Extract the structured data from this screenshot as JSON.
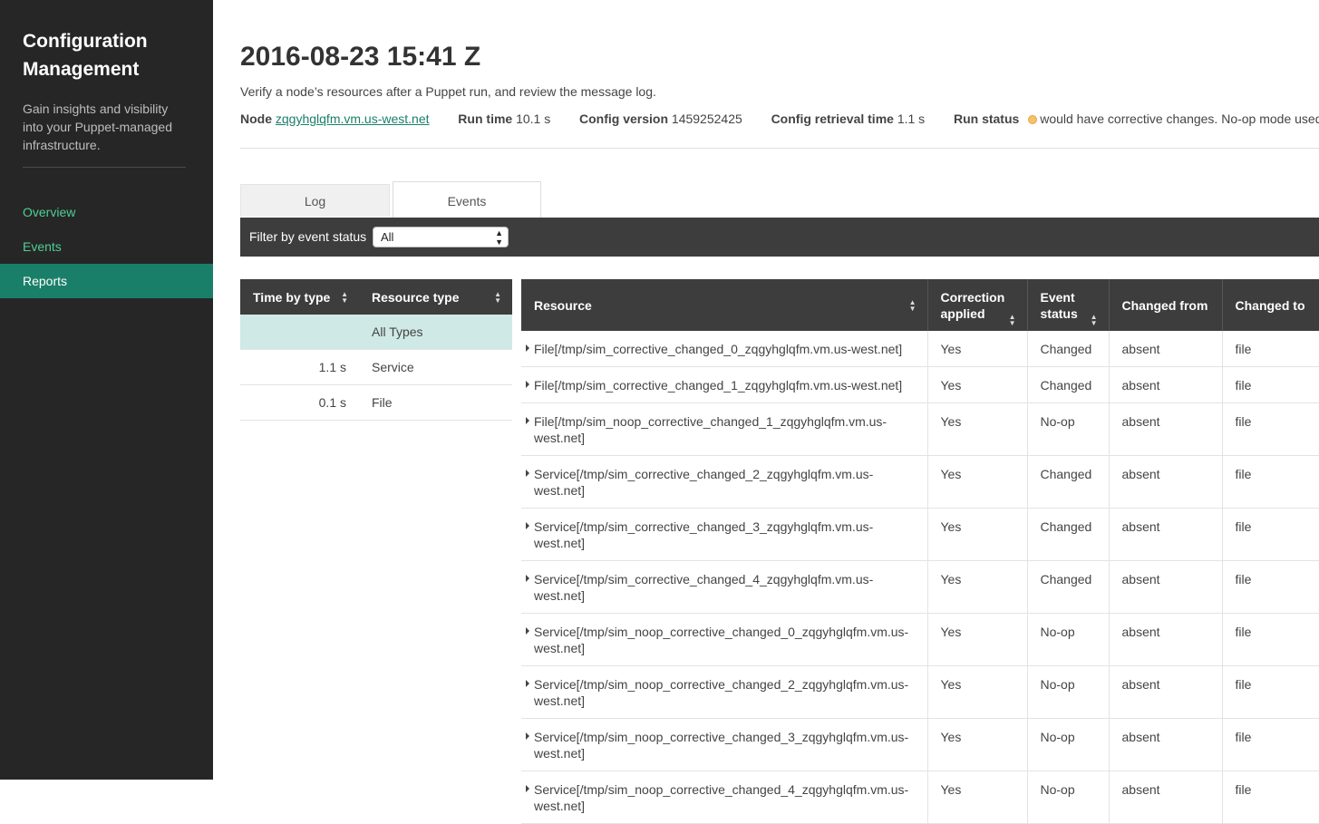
{
  "sidebar": {
    "title": "Configuration Management",
    "tagline": "Gain insights and visibility into your Puppet-managed infrastructure.",
    "nav": [
      {
        "label": "Overview"
      },
      {
        "label": "Events"
      },
      {
        "label": "Reports"
      }
    ]
  },
  "header": {
    "title": "2016-08-23 15:41 Z",
    "subtitle": "Verify a node’s resources after a Puppet run, and review the message log."
  },
  "meta": {
    "node_label": "Node",
    "node_value": "zqgyhglqfm.vm.us-west.net",
    "run_time_label": "Run time",
    "run_time_value": "10.1 s",
    "config_version_label": "Config version",
    "config_version_value": "1459252425",
    "config_retrieval_label": "Config retrieval time",
    "config_retrieval_value": "1.1 s",
    "run_status_label": "Run status",
    "run_status_value": "would have corrective changes. No-op mode used."
  },
  "tabs": [
    {
      "label": "Log"
    },
    {
      "label": "Events"
    }
  ],
  "filter": {
    "label": "Filter by event status",
    "selected": "All"
  },
  "types_table": {
    "headers": {
      "time": "Time by type",
      "type": "Resource type"
    },
    "rows": [
      {
        "time": "",
        "type": "All Types"
      },
      {
        "time": "1.1 s",
        "type": "Service"
      },
      {
        "time": "0.1 s",
        "type": "File"
      }
    ]
  },
  "events_table": {
    "headers": {
      "resource": "Resource",
      "correction": "Correction applied",
      "status": "Event status",
      "from": "Changed from",
      "to": "Changed to"
    },
    "rows": [
      {
        "resource": "File[/tmp/sim_corrective_changed_0_zqgyhglqfm.vm.us-west.net]",
        "correction": "Yes",
        "status": "Changed",
        "from": "absent",
        "to": "file"
      },
      {
        "resource": "File[/tmp/sim_corrective_changed_1_zqgyhglqfm.vm.us-west.net]",
        "correction": "Yes",
        "status": "Changed",
        "from": "absent",
        "to": "file"
      },
      {
        "resource": "File[/tmp/sim_noop_corrective_changed_1_zqgyhglqfm.vm.us-west.net]",
        "correction": "Yes",
        "status": "No-op",
        "from": "absent",
        "to": "file"
      },
      {
        "resource": "Service[/tmp/sim_corrective_changed_2_zqgyhglqfm.vm.us-west.net]",
        "correction": "Yes",
        "status": "Changed",
        "from": "absent",
        "to": "file"
      },
      {
        "resource": "Service[/tmp/sim_corrective_changed_3_zqgyhglqfm.vm.us-west.net]",
        "correction": "Yes",
        "status": "Changed",
        "from": "absent",
        "to": "file"
      },
      {
        "resource": "Service[/tmp/sim_corrective_changed_4_zqgyhglqfm.vm.us-west.net]",
        "correction": "Yes",
        "status": "Changed",
        "from": "absent",
        "to": "file"
      },
      {
        "resource": "Service[/tmp/sim_noop_corrective_changed_0_zqgyhglqfm.vm.us-west.net]",
        "correction": "Yes",
        "status": "No-op",
        "from": "absent",
        "to": "file"
      },
      {
        "resource": "Service[/tmp/sim_noop_corrective_changed_2_zqgyhglqfm.vm.us-west.net]",
        "correction": "Yes",
        "status": "No-op",
        "from": "absent",
        "to": "file"
      },
      {
        "resource": "Service[/tmp/sim_noop_corrective_changed_3_zqgyhglqfm.vm.us-west.net]",
        "correction": "Yes",
        "status": "No-op",
        "from": "absent",
        "to": "file"
      },
      {
        "resource": "Service[/tmp/sim_noop_corrective_changed_4_zqgyhglqfm.vm.us-west.net]",
        "correction": "Yes",
        "status": "No-op",
        "from": "absent",
        "to": "file"
      }
    ]
  }
}
